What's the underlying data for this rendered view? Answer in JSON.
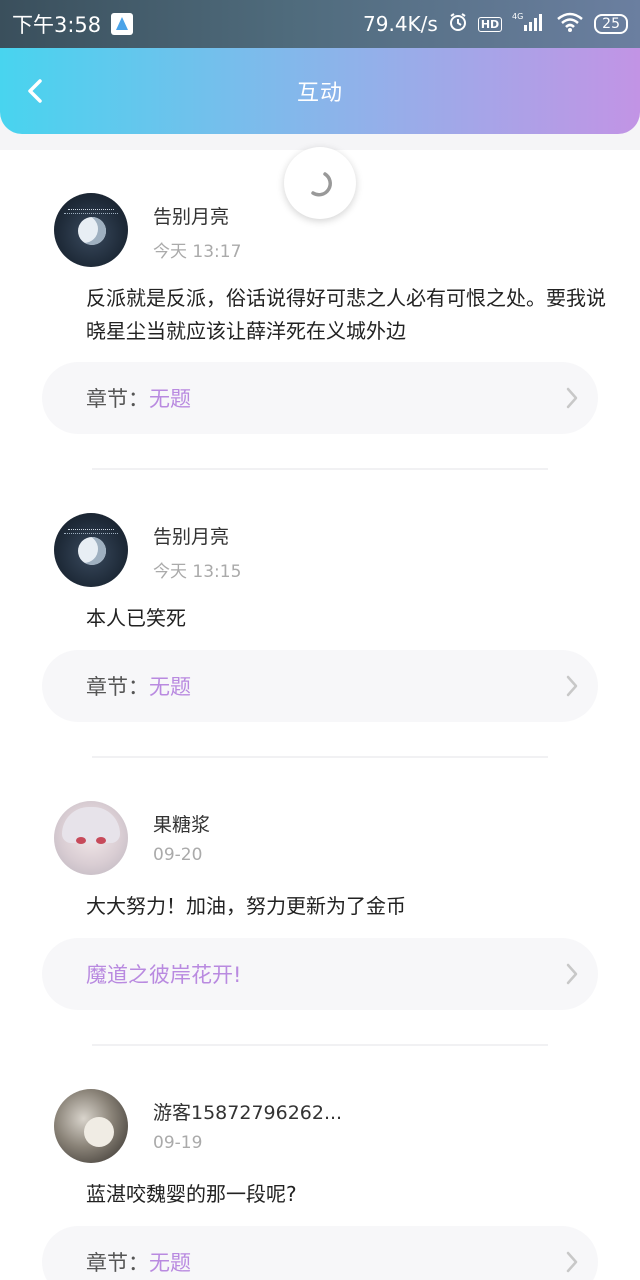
{
  "status_bar": {
    "time": "下午3:58",
    "net_speed": "79.4K/s",
    "hd_label": "HD",
    "signal_label": "4G",
    "battery": "25"
  },
  "header": {
    "title": "互动"
  },
  "comments": [
    {
      "username": "告别月亮",
      "date": "今天 13:17",
      "content": "反派就是反派，俗话说得好可悲之人必有可恨之处。要我说晓星尘当就应该让薛洋死在义城外边",
      "chapter_key": "章节：",
      "chapter_value": "无题"
    },
    {
      "username": "告别月亮",
      "date": "今天 13:15",
      "content": "本人已笑死",
      "chapter_key": "章节：",
      "chapter_value": "无题"
    },
    {
      "username": "果糖浆",
      "date": "09-20",
      "content": "大大努力！加油，努力更新为了金币",
      "chapter_key": "",
      "chapter_value": "魔道之彼岸花开!"
    },
    {
      "username": "游客15872796262...",
      "date": "09-19",
      "content": "蓝湛咬魏婴的那一段呢?",
      "chapter_key": "章节：",
      "chapter_value": "无题"
    }
  ],
  "colors": {
    "accent": "#b98ae0",
    "header_start": "#48d4ef",
    "header_end": "#c294e5"
  }
}
